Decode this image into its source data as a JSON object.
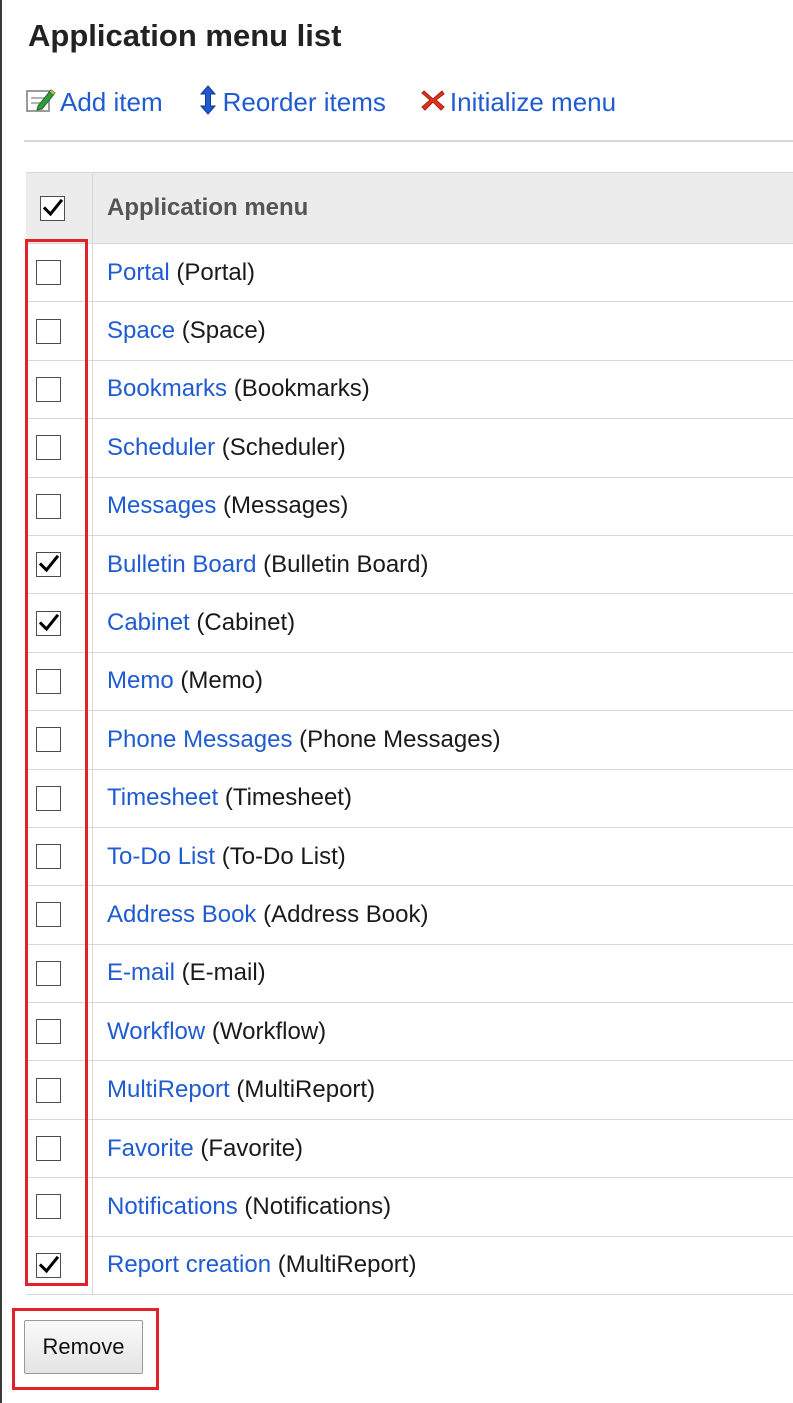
{
  "page": {
    "title": "Application menu list"
  },
  "toolbar": {
    "add_label": "Add item",
    "reorder_label": "Reorder items",
    "initialize_label": "Initialize menu"
  },
  "table": {
    "header": "Application menu",
    "header_checked": true,
    "rows": [
      {
        "name": "Portal",
        "app": " (Portal)",
        "checked": false
      },
      {
        "name": "Space",
        "app": " (Space)",
        "checked": false
      },
      {
        "name": "Bookmarks",
        "app": " (Bookmarks)",
        "checked": false
      },
      {
        "name": "Scheduler",
        "app": " (Scheduler)",
        "checked": false
      },
      {
        "name": "Messages",
        "app": " (Messages)",
        "checked": false
      },
      {
        "name": "Bulletin Board",
        "app": " (Bulletin Board)",
        "checked": true
      },
      {
        "name": "Cabinet",
        "app": " (Cabinet)",
        "checked": true
      },
      {
        "name": "Memo",
        "app": " (Memo)",
        "checked": false
      },
      {
        "name": "Phone Messages",
        "app": " (Phone Messages)",
        "checked": false
      },
      {
        "name": "Timesheet",
        "app": " (Timesheet)",
        "checked": false
      },
      {
        "name": "To-Do List",
        "app": " (To-Do List)",
        "checked": false
      },
      {
        "name": "Address Book",
        "app": " (Address Book)",
        "checked": false
      },
      {
        "name": "E-mail",
        "app": " (E-mail)",
        "checked": false
      },
      {
        "name": "Workflow",
        "app": " (Workflow)",
        "checked": false
      },
      {
        "name": "MultiReport",
        "app": " (MultiReport)",
        "checked": false
      },
      {
        "name": "Favorite",
        "app": " (Favorite)",
        "checked": false
      },
      {
        "name": "Notifications",
        "app": " (Notifications)",
        "checked": false
      },
      {
        "name": "Report creation",
        "app": " (MultiReport)",
        "checked": true
      }
    ]
  },
  "actions": {
    "remove_label": "Remove"
  },
  "colors": {
    "link": "#1f5bd1",
    "highlight": "#e0222b",
    "header_bg": "#ececec"
  },
  "icons": {
    "add": "edit-note-icon",
    "reorder": "up-down-arrow-icon",
    "initialize": "red-x-icon"
  }
}
